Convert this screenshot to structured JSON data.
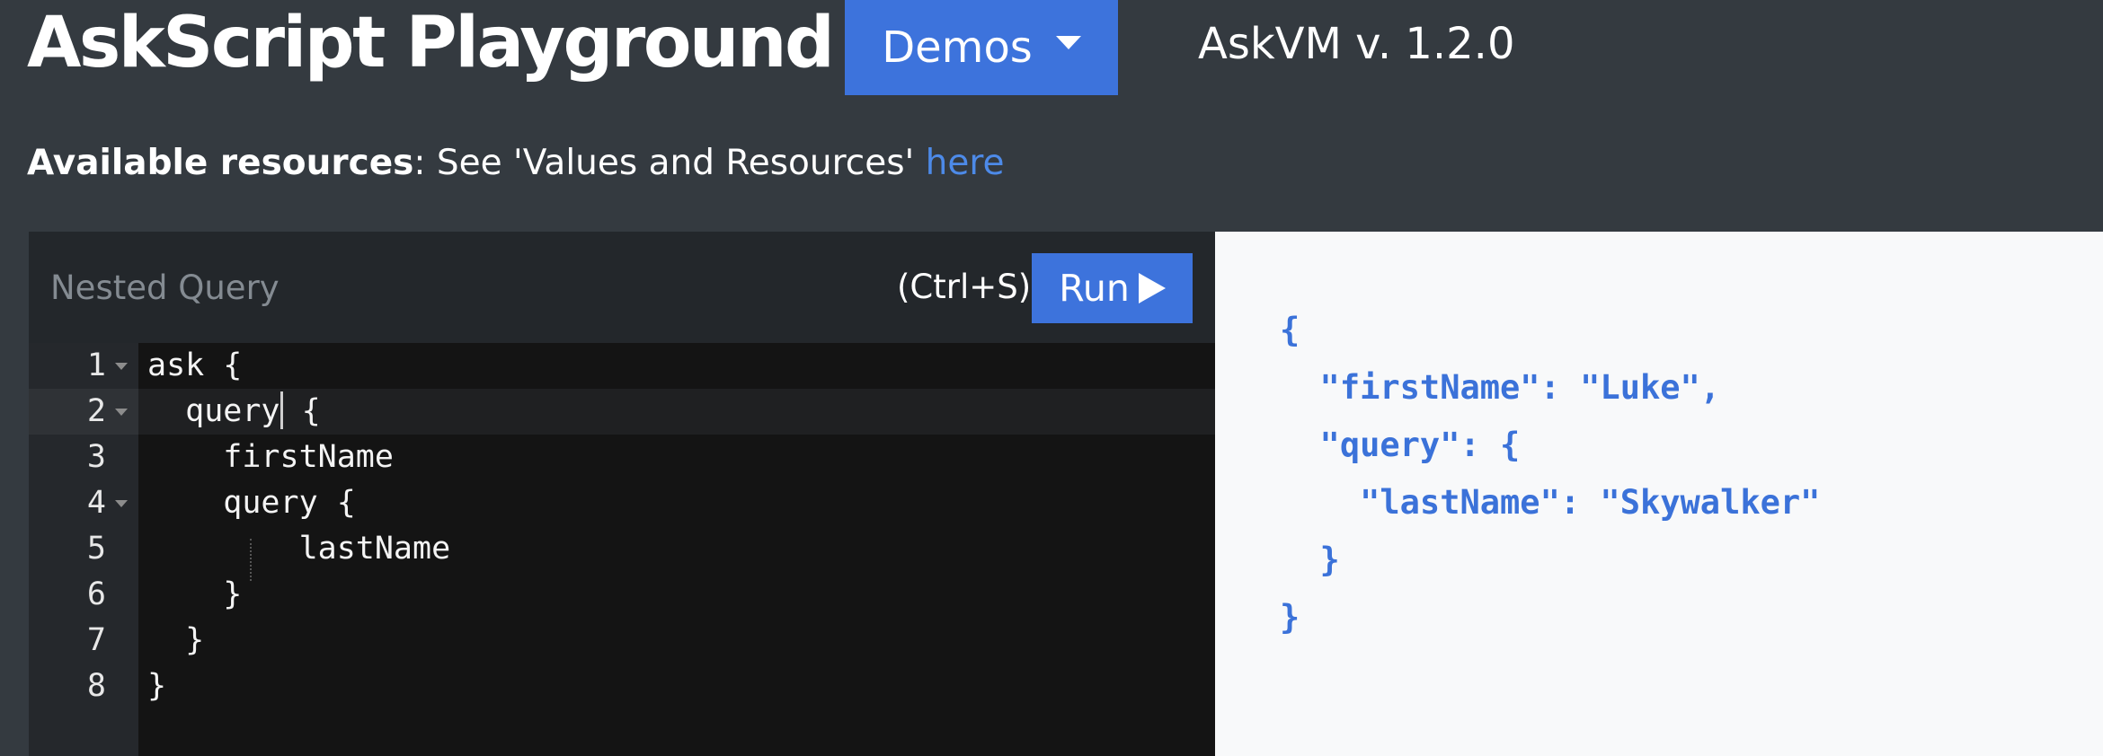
{
  "header": {
    "title": "AskScript Playground",
    "demos_label": "Demos",
    "version": "AskVM v. 1.2.0"
  },
  "resources": {
    "label": "Available resources",
    "text": ": See 'Values and Resources' ",
    "link_text": "here"
  },
  "editor": {
    "script_title": "Nested Query",
    "shortcut": "(Ctrl+S)",
    "run_label": "Run",
    "lines": [
      {
        "number": "1",
        "code": "ask {"
      },
      {
        "number": "2",
        "code": "  query"
      },
      {
        "number": "3",
        "code": "    firstName"
      },
      {
        "number": "4",
        "code": "    query {"
      },
      {
        "number": "5",
        "code": "        lastName"
      },
      {
        "number": "6",
        "code": "    }"
      },
      {
        "number": "7",
        "code": "  }"
      },
      {
        "number": "8",
        "code": "}"
      }
    ],
    "line2_after_cursor": " {"
  },
  "output": {
    "text": "{\n  \"firstName\": \"Luke\",\n  \"query\": {\n    \"lastName\": \"Skywalker\"\n  }\n}"
  },
  "colors": {
    "accent": "#3d73dc",
    "link": "#4d8ae8",
    "header_bg": "#343a40",
    "output_text": "#3b72d9"
  },
  "icons": {
    "demos": "chevron-down-icon",
    "run": "play-icon",
    "fold": "fold-arrow-icon"
  }
}
